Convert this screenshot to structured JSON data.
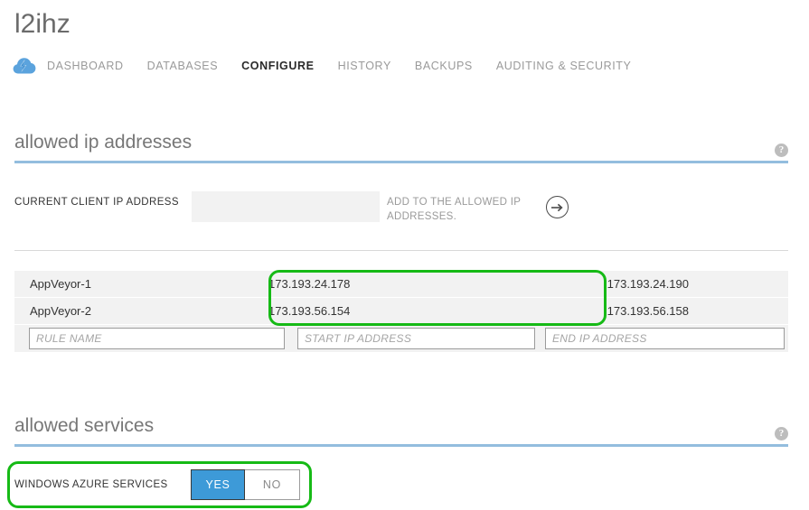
{
  "header": {
    "title": "l2ihz",
    "brand_icon": "azure-cloud-icon",
    "tabs": [
      {
        "label": "DASHBOARD",
        "active": false
      },
      {
        "label": "DATABASES",
        "active": false
      },
      {
        "label": "CONFIGURE",
        "active": true
      },
      {
        "label": "HISTORY",
        "active": false
      },
      {
        "label": "BACKUPS",
        "active": false
      },
      {
        "label": "AUDITING & SECURITY",
        "active": false
      }
    ]
  },
  "allowed_ip": {
    "section_title": "allowed ip addresses",
    "help_glyph": "?",
    "client_ip": {
      "label": "CURRENT CLIENT IP ADDRESS",
      "value": "",
      "add_hint": "ADD TO THE ALLOWED IP ADDRESSES.",
      "submit_icon": "arrow-right-circle-icon"
    },
    "rules": [
      {
        "name": "AppVeyor-1",
        "start_ip": "173.193.24.178",
        "end_ip": "173.193.24.190"
      },
      {
        "name": "AppVeyor-2",
        "start_ip": "173.193.56.154",
        "end_ip": "173.193.56.158"
      }
    ],
    "new_rule": {
      "name_value": "",
      "name_placeholder": "RULE NAME",
      "start_value": "",
      "start_placeholder": "START IP ADDRESS",
      "end_value": "",
      "end_placeholder": "END IP ADDRESS"
    }
  },
  "allowed_services": {
    "section_title": "allowed services",
    "help_glyph": "?",
    "windows_azure_services": {
      "label": "WINDOWS AZURE SERVICES",
      "options": [
        {
          "label": "YES",
          "selected": true
        },
        {
          "label": "NO",
          "selected": false
        }
      ]
    }
  },
  "annotations": {
    "highlight_color": "#16ba16",
    "boxes": [
      {
        "name": "ip-range-highlight"
      },
      {
        "name": "azure-services-toggle-highlight"
      }
    ]
  },
  "colors": {
    "accent_blue": "#3d9ad8",
    "rule_blue": "#93bdde",
    "row_grey": "#f2f2f2"
  }
}
